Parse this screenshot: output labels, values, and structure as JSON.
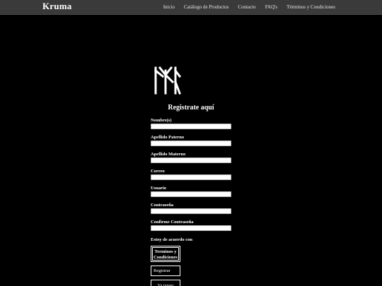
{
  "navbar": {
    "brand": "Kruma",
    "links": [
      "Inicio",
      "Catálogo de Productos",
      "Contacto",
      "FAQ's",
      "Términos y Condiciones"
    ]
  },
  "logo": {
    "icon": "kruma-rune-logo-icon",
    "color": "#ffffff"
  },
  "form": {
    "title": "Registrate aquí",
    "fields": [
      {
        "label": "Nombre(s)",
        "value": ""
      },
      {
        "label": "Apellido Paterno",
        "value": ""
      },
      {
        "label": "Apellido Materno",
        "value": ""
      },
      {
        "label": "Correo",
        "value": ""
      },
      {
        "label": "Usuario",
        "value": ""
      },
      {
        "label": "Contraseña",
        "value": ""
      },
      {
        "label": "Confirme Contraseña",
        "value": ""
      }
    ],
    "agree_label": "Estoy de acuerdo con",
    "terms_button": "Terminos y Condiciones",
    "register_button": "Registrar",
    "already_button": "Ya tengo"
  },
  "colors": {
    "background": "#000000",
    "navbar": "#3a3a3a",
    "text": "#ffffff"
  }
}
